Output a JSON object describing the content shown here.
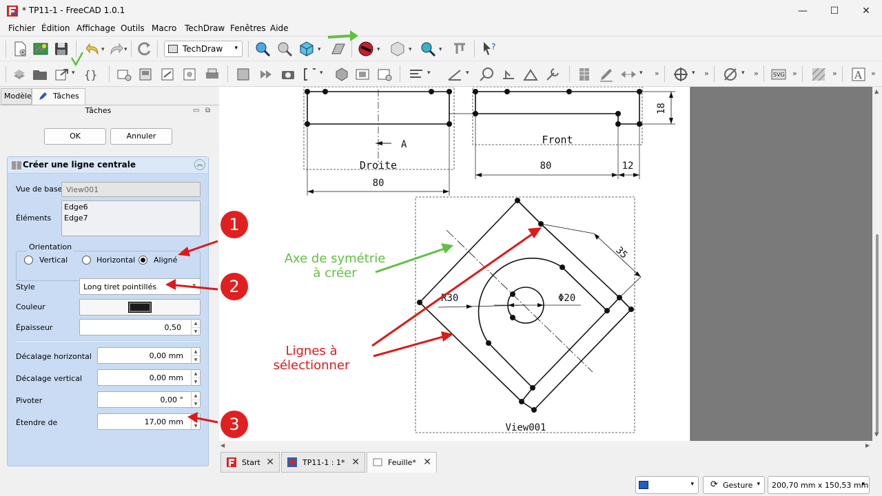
{
  "window": {
    "title": "* TP11-1 - FreeCAD 1.0.1",
    "controls": [
      "—",
      "☐",
      "✕"
    ]
  },
  "menu": [
    "Fichier",
    "Édition",
    "Affichage",
    "Outils",
    "Macro",
    "TechDraw",
    "Fenêtres",
    "Aide"
  ],
  "toolbar": {
    "workbench": "TechDraw"
  },
  "panel": {
    "tabs": {
      "model": "Modèle",
      "tasks": "Tâches"
    },
    "title": "Tâches",
    "ok": "OK",
    "cancel": "Annuler",
    "task": {
      "title": "Créer une ligne centrale",
      "base_view_label": "Vue de base",
      "base_view_value": "View001",
      "elements_label": "Éléments",
      "elements": [
        "Edge6",
        "Edge7"
      ],
      "orientation_label": "Orientation",
      "orientations": [
        "Vertical",
        "Horizontal",
        "Aligné"
      ],
      "orientation_selected": "Aligné",
      "style_label": "Style",
      "style_value": "Long tiret pointillés",
      "color_label": "Couleur",
      "color_value": "#1a1a1a",
      "thickness_label": "Épaisseur",
      "thickness_value": "0,50",
      "hshift_label": "Décalage horizontal",
      "hshift_value": "0,00 mm",
      "vshift_label": "Décalage vertical",
      "vshift_value": "0,00 mm",
      "rotate_label": "Pivoter",
      "rotate_value": "0,00 °",
      "extend_label": "Étendre de",
      "extend_value": "17,00 mm"
    }
  },
  "drawing": {
    "view_labels": {
      "right": "Droite",
      "front": "Front",
      "base": "View001"
    },
    "section_label": "A",
    "dims": {
      "d80_left": "80",
      "d80_right": "80",
      "d12": "12",
      "d18": "18",
      "d35": "35",
      "r30": "R30",
      "phi20": "Φ20"
    }
  },
  "annotations": {
    "badges": [
      "1",
      "2",
      "3"
    ],
    "axis": [
      "Axe de symétrie",
      "à créer"
    ],
    "lines": [
      "Lignes à",
      "sélectionner"
    ],
    "green_color": "#60c040",
    "red_color": "#e01818"
  },
  "doc_tabs": [
    "Start",
    "TP11-1 : 1*",
    "Feuille*"
  ],
  "status": {
    "nav_style": "Gesture",
    "dimensions": "200,70 mm x 150,53 mm"
  }
}
